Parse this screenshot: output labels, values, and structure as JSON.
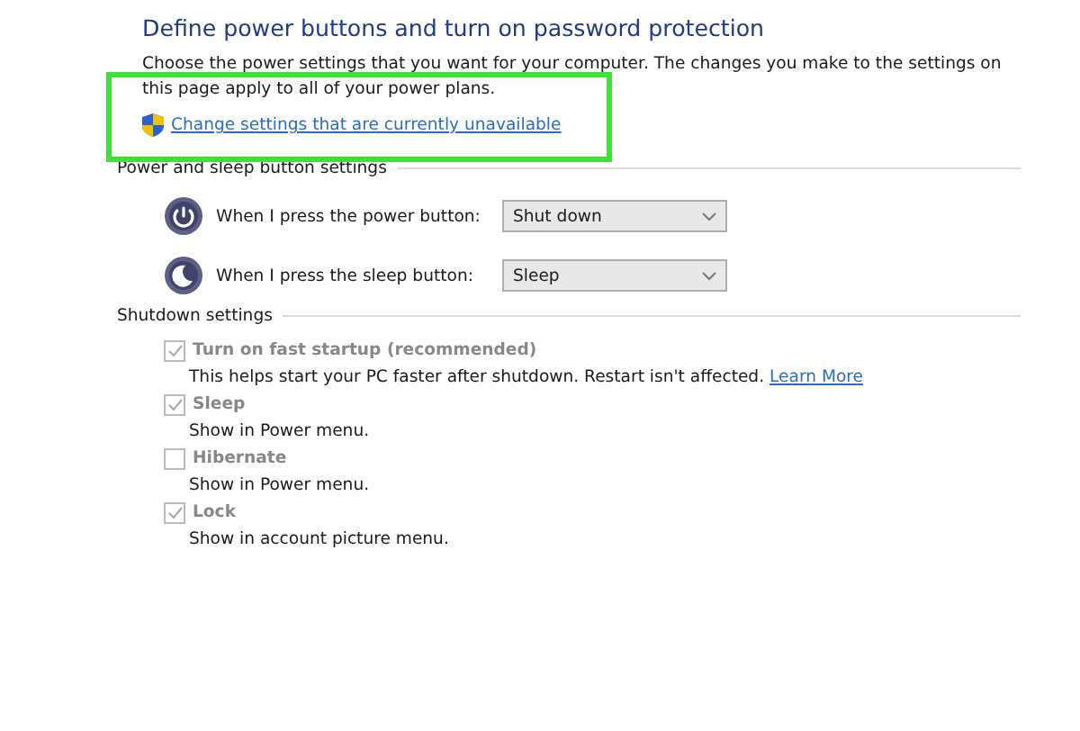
{
  "heading": "Define power buttons and turn on password protection",
  "description": "Choose the power settings that you want for your computer. The changes you make to the settings on this page apply to all of your power plans.",
  "admin_link": {
    "label": "Change settings that are currently unavailable",
    "highlighted": true
  },
  "power_section": {
    "title": "Power and sleep button settings",
    "rows": [
      {
        "kind": "power",
        "label": "When I press the power button:",
        "value": "Shut down"
      },
      {
        "kind": "sleep",
        "label": "When I press the sleep button:",
        "value": "Sleep"
      }
    ]
  },
  "shutdown_section": {
    "title": "Shutdown settings",
    "items": [
      {
        "label": "Turn on fast startup (recommended)",
        "checked": true,
        "disabled": true,
        "description": "This helps start your PC faster after shutdown. Restart isn't affected.",
        "link": "Learn More"
      },
      {
        "label": "Sleep",
        "checked": true,
        "disabled": true,
        "description": "Show in Power menu."
      },
      {
        "label": "Hibernate",
        "checked": false,
        "disabled": true,
        "description": "Show in Power menu."
      },
      {
        "label": "Lock",
        "checked": true,
        "disabled": true,
        "description": "Show in account picture menu."
      }
    ]
  }
}
